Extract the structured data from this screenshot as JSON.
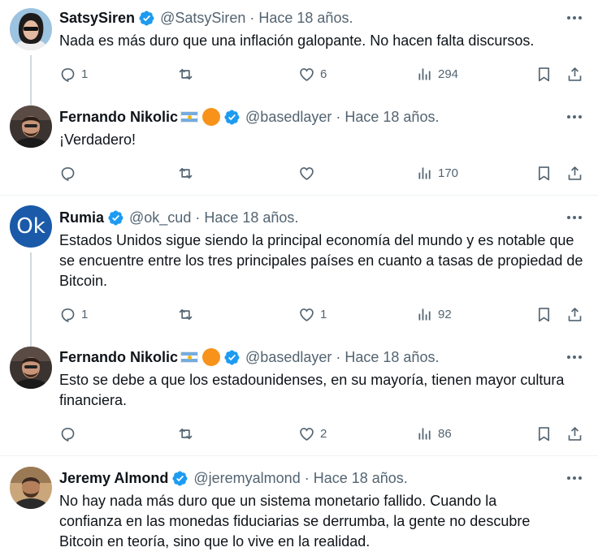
{
  "tweets": [
    {
      "name": "SatsySiren",
      "handle": "@SatsySiren",
      "time": "Hace 18 años.",
      "text": "Nada es más duro que una inflación galopante. No hacen falta discursos.",
      "replies": "1",
      "retweets": "",
      "likes": "6",
      "views": "294"
    },
    {
      "name": "Fernando Nikolic",
      "handle": "@basedlayer",
      "time": "Hace 18 años.",
      "text": "¡Verdadero!",
      "replies": "",
      "retweets": "",
      "likes": "",
      "views": "170"
    },
    {
      "name": "Rumia",
      "handle": "@ok_cud",
      "time": "Hace 18 años.",
      "avatar_text": "Ok",
      "text": "Estados Unidos sigue siendo la principal economía del mundo y es notable que se encuentre entre los tres principales países en cuanto a tasas de propiedad de Bitcoin.",
      "replies": "1",
      "retweets": "",
      "likes": "1",
      "views": "92"
    },
    {
      "name": "Fernando Nikolic",
      "handle": "@basedlayer",
      "time": "Hace 18 años.",
      "text": "Esto se debe a que los estadounidenses, en su mayoría, tienen mayor cultura financiera.",
      "replies": "",
      "retweets": "",
      "likes": "2",
      "views": "86"
    },
    {
      "name": "Jeremy Almond",
      "handle": "@jeremyalmond",
      "time": "Hace 18 años.",
      "text": "No hay nada más duro que un sistema monetario fallido. Cuando la confianza en las monedas fiduciarias se derrumba, la gente no descubre Bitcoin en teoría, sino que lo vive en la realidad."
    }
  ],
  "colors": {
    "verified": "#1d9bf0",
    "muted": "#536471",
    "separator": "#eff3f4",
    "rumia_avatar": "#1a5aa8"
  },
  "icons": [
    "verified-badge-icon",
    "argentina-flag-icon",
    "bitcoin-orange-dot-icon",
    "more-icon",
    "reply-icon",
    "retweet-icon",
    "like-icon",
    "views-icon",
    "bookmark-icon",
    "share-icon"
  ]
}
